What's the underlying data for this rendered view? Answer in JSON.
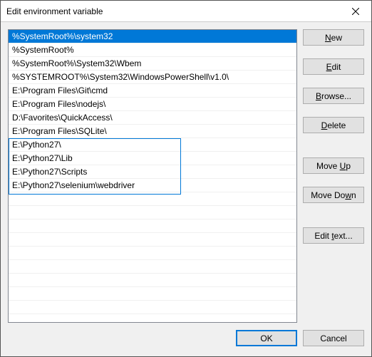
{
  "title": "Edit environment variable",
  "list": {
    "items": [
      "%SystemRoot%\\system32",
      "%SystemRoot%",
      "%SystemRoot%\\System32\\Wbem",
      "%SYSTEMROOT%\\System32\\WindowsPowerShell\\v1.0\\",
      "E:\\Program Files\\Git\\cmd",
      "E:\\Program Files\\nodejs\\",
      "D:\\Favorites\\QuickAccess\\",
      "E:\\Program Files\\SQLite\\",
      "E:\\Python27\\",
      "E:\\Python27\\Lib",
      "E:\\Python27\\Scripts",
      "E:\\Python27\\selenium\\webdriver"
    ],
    "selected_index": 0,
    "edit_group_start": 8,
    "edit_group_end": 11
  },
  "buttons": {
    "new": "New",
    "edit": "Edit",
    "browse": "Browse...",
    "delete": "Delete",
    "move_up": "Move Up",
    "move_down": "Move Down",
    "edit_text": "Edit text...",
    "ok": "OK",
    "cancel": "Cancel"
  }
}
